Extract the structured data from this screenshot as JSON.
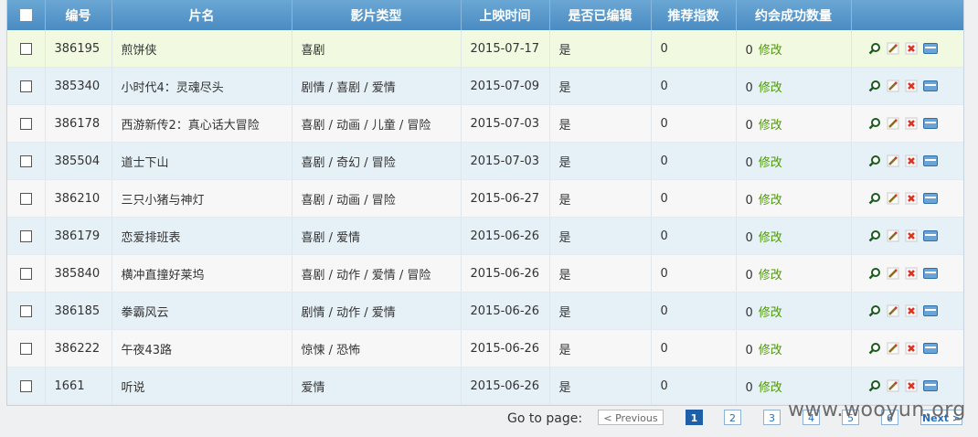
{
  "headers": [
    "编号",
    "片名",
    "影片类型",
    "上映时间",
    "是否已编辑",
    "推荐指数",
    "约会成功数量",
    ""
  ],
  "edit_label": "修改",
  "rows": [
    {
      "id": "386195",
      "title": "煎饼侠",
      "genre": "喜剧",
      "date": "2015-07-17",
      "edited": "是",
      "rating": "0",
      "dates_count": "0"
    },
    {
      "id": "385340",
      "title": "小时代4：灵魂尽头",
      "genre": "剧情 / 喜剧 / 爱情",
      "date": "2015-07-09",
      "edited": "是",
      "rating": "0",
      "dates_count": "0"
    },
    {
      "id": "386178",
      "title": "西游新传2：真心话大冒险",
      "genre": "喜剧 / 动画 / 儿童 / 冒险",
      "date": "2015-07-03",
      "edited": "是",
      "rating": "0",
      "dates_count": "0"
    },
    {
      "id": "385504",
      "title": "道士下山",
      "genre": "喜剧 / 奇幻 / 冒险",
      "date": "2015-07-03",
      "edited": "是",
      "rating": "0",
      "dates_count": "0"
    },
    {
      "id": "386210",
      "title": "三只小猪与神灯",
      "genre": "喜剧 / 动画 / 冒险",
      "date": "2015-06-27",
      "edited": "是",
      "rating": "0",
      "dates_count": "0"
    },
    {
      "id": "386179",
      "title": "恋爱排班表",
      "genre": "喜剧 / 爱情",
      "date": "2015-06-26",
      "edited": "是",
      "rating": "0",
      "dates_count": "0"
    },
    {
      "id": "385840",
      "title": "横冲直撞好莱坞",
      "genre": "喜剧 / 动作 / 爱情 / 冒险",
      "date": "2015-06-26",
      "edited": "是",
      "rating": "0",
      "dates_count": "0"
    },
    {
      "id": "386185",
      "title": "拳霸风云",
      "genre": "剧情 / 动作 / 爱情",
      "date": "2015-06-26",
      "edited": "是",
      "rating": "0",
      "dates_count": "0"
    },
    {
      "id": "386222",
      "title": "午夜43路",
      "genre": "惊悚 / 恐怖",
      "date": "2015-06-26",
      "edited": "是",
      "rating": "0",
      "dates_count": "0"
    },
    {
      "id": "1661",
      "title": "听说",
      "genre": "爱情",
      "date": "2015-06-26",
      "edited": "是",
      "rating": "0",
      "dates_count": "0"
    }
  ],
  "pager": {
    "goto_label": "Go to page:",
    "prev_label": "< Previous",
    "pages": [
      "1",
      "2",
      "3",
      "4",
      "5",
      "6"
    ],
    "current": "1",
    "next_label": "Next >"
  },
  "watermark": "www.wooyun.org",
  "colors": {
    "header": "#4a8bc2",
    "active_row": "#f1f9e1",
    "edit_link": "#4e9a06",
    "current_page": "#1f5fa8"
  },
  "row_icons": [
    "view-icon",
    "pencil-icon",
    "delete-icon",
    "detail-icon"
  ]
}
